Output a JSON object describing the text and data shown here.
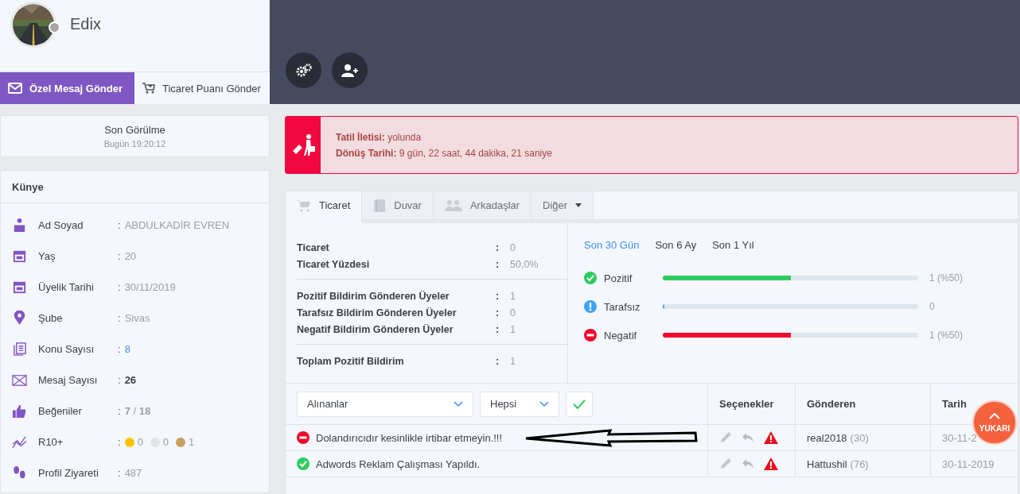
{
  "profile": {
    "name": "Edix",
    "online": false
  },
  "actions": [
    {
      "label": "Özel Mesaj Gönder",
      "kind": "primary"
    },
    {
      "label": "Ticaret Puanı Gönder",
      "kind": "plain"
    }
  ],
  "last_seen": {
    "title": "Son Görülme",
    "time": "Bugün 19:20:12"
  },
  "kunye": {
    "title": "Künye",
    "rows": [
      {
        "label": "Ad Soyad",
        "separator": ":",
        "value": "ABDULKADİR EVREN",
        "kind": "plain"
      },
      {
        "label": "Yaş",
        "separator": ":",
        "value": "20",
        "kind": "plain"
      },
      {
        "label": "Üyelik Tarihi",
        "separator": ":",
        "value": "30/11/2019",
        "kind": "plain"
      },
      {
        "label": "Şube",
        "separator": ":",
        "value": "Sivas",
        "kind": "plain"
      },
      {
        "label": "Konu Sayısı",
        "separator": ":",
        "value": "8",
        "kind": "link"
      },
      {
        "label": "Mesaj Sayısı",
        "separator": ":",
        "value": "26",
        "kind": "bold"
      },
      {
        "label": "Beğeniler",
        "separator": ":",
        "value": "**7** / **18**",
        "kind": "plain"
      },
      {
        "label": "R10+",
        "separator": ":",
        "kind": "medals",
        "medals": [
          {
            "color": "#ffc400",
            "count": "0"
          },
          {
            "color": "#e3e3e3",
            "count": "0"
          },
          {
            "color": "#c9a060",
            "count": "1"
          }
        ]
      },
      {
        "label": "Profil Ziyareti",
        "separator": ":",
        "value": "487",
        "kind": "plain"
      }
    ]
  },
  "alert": {
    "lines": [
      "**Tatil İletisi:** yolunda",
      "**Dönüş Tarihi:** 9 gün, 22 saat, 44 dakika, 21 saniye"
    ]
  },
  "tabs": [
    {
      "label": "Ticaret",
      "selected": true,
      "kind": "tab"
    },
    {
      "label": "Duvar",
      "selected": false,
      "kind": "tab"
    },
    {
      "label": "Arkadaşlar",
      "selected": false,
      "kind": "tab"
    },
    {
      "label": "Diğer",
      "selected": false,
      "kind": "dropdown"
    }
  ],
  "stats": [
    [
      {
        "label": "Ticaret",
        "separator": ":",
        "value": "0"
      },
      {
        "label": "Ticaret Yüzdesi",
        "separator": ":",
        "value": "50,0%"
      }
    ],
    [
      {
        "label": "Pozitif Bildirim Gönderen Üyeler",
        "separator": ":",
        "value": "1"
      },
      {
        "label": "Tarafsız Bildirim Gönderen Üyeler",
        "separator": ":",
        "value": "0"
      },
      {
        "label": "Negatif Bildirim Gönderen Üyeler",
        "separator": ":",
        "value": "1"
      }
    ],
    [
      {
        "label": "Toplam Pozitif Bildirim",
        "separator": ":",
        "value": "1"
      }
    ]
  ],
  "periods": [
    {
      "label": "Son 30 Gün",
      "selected": true
    },
    {
      "label": "Son 6 Ay",
      "selected": false
    },
    {
      "label": "Son 1 Yıl",
      "selected": false
    }
  ],
  "meters": [
    {
      "kind": "positive",
      "label": "Pozitif",
      "level": 0.5,
      "reading": "1 (%50)"
    },
    {
      "kind": "neutral",
      "label": "Tarafsız",
      "level": 0,
      "reading": "0"
    },
    {
      "kind": "negative",
      "label": "Negatif",
      "level": 0.5,
      "reading": "1 (%50)"
    }
  ],
  "filters": {
    "folder": "Alınanlar",
    "scope": "Hepsi"
  },
  "columns": [
    "Seçenekler",
    "Gönderen",
    "Tarih"
  ],
  "rows": [
    {
      "kind": "negative",
      "message": "Dolandırıcıdır kesinlikle irtibar etmeyin.!!!",
      "sender": "real2018",
      "count": "(30)",
      "date": "30-11-2",
      "annotated": true
    },
    {
      "kind": "positive",
      "message": "Adwords Reklam Çalışması Yapıldı.",
      "sender": "Hattushil",
      "count": "(76)",
      "date": "30-11-2019",
      "annotated": false
    }
  ],
  "scroll_top": "YUKARI"
}
